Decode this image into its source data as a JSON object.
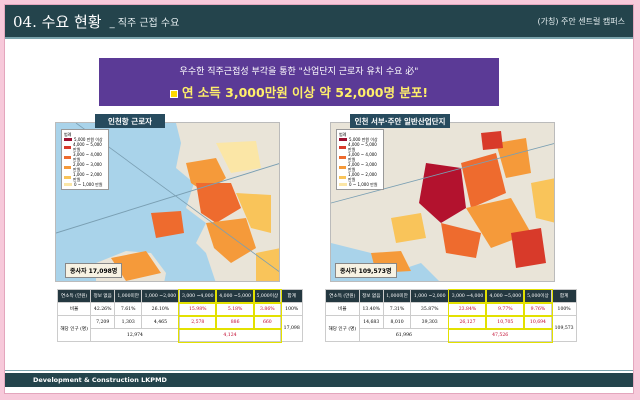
{
  "header": {
    "title": "04. 수요 현황",
    "subtitle": "_ 직주 근접 수요",
    "project": "(가칭) 주안 센트럴 캠퍼스"
  },
  "banner": {
    "line1": "우수한 직주근접성 부각을 통한 \"산업단지 근로자 유치 수요 必\"",
    "line2": "연 소득 3,000만원 이상 약 52,000명 분포!"
  },
  "maps": [
    {
      "title": "인천항 근로자",
      "workers": "종사자 17,098명"
    },
    {
      "title": "인천 서부·주안 일반산업단지",
      "workers": "종사자 109,573명"
    }
  ],
  "legend": {
    "title": "범례",
    "items": [
      "0 ~ 1,000 만원",
      "1,000 ~ 2,000 만원",
      "2,000 ~ 3,000 만원",
      "3,000 ~ 4,000 만원",
      "4,000 ~ 5,000 만원",
      "5,000 만원 이상"
    ],
    "colors": [
      "#fbe6a6",
      "#f9c45a",
      "#f59a3a",
      "#ee6b2e",
      "#d83a2a",
      "#9b1030"
    ]
  },
  "tables": [
    {
      "header": [
        "연소득 (만원)",
        "정보 없음",
        "1,000미만",
        "1,000 ~2,000",
        "3,000 ~4,000",
        "4,000 ~5,000",
        "5,000이상",
        "합계"
      ],
      "ratio_label": "비율",
      "ratio": [
        "42.26%",
        "7.61%",
        "26.10%",
        "15.98%",
        "5.18%",
        "3.86%",
        "100%"
      ],
      "pop_label": "해당 인구 (명)",
      "pop": [
        "7,209",
        "1,303",
        "4,465",
        "2,578",
        "886",
        "660"
      ],
      "pop_total": "17,098",
      "sub_left": "12,974",
      "sub_right": "4,124"
    },
    {
      "header": [
        "연소득 (만원)",
        "정보 없음",
        "1,000미만",
        "1,000 ~2,000",
        "3,000 ~4,000",
        "4,000 ~5,000",
        "5,000이상",
        "합계"
      ],
      "ratio_label": "비율",
      "ratio": [
        "13.40%",
        "7.31%",
        "35.87%",
        "23.84%",
        "9.77%",
        "9.76%",
        "100%"
      ],
      "pop_label": "해당 인구 (명)",
      "pop": [
        "14,683",
        "8,010",
        "39,303",
        "26,127",
        "10,705",
        "10,694"
      ],
      "pop_total": "109,573",
      "sub_left": "61,996",
      "sub_right": "47,526"
    }
  ],
  "footer": "Development & Construction LKPMD"
}
